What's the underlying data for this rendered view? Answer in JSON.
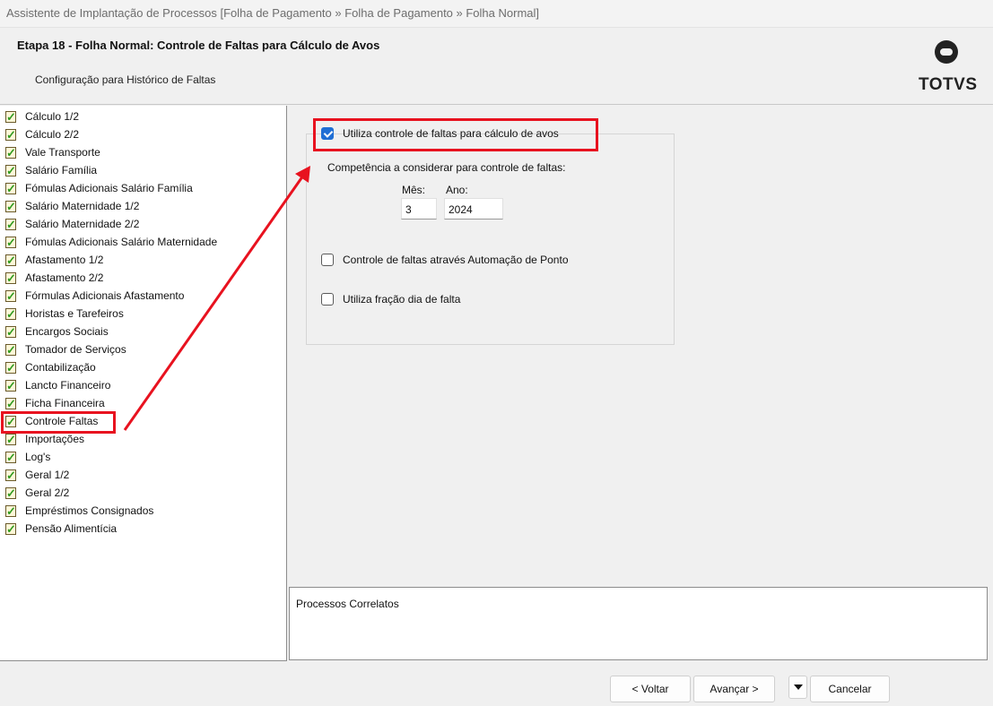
{
  "window": {
    "title": "Assistente de Implantação de Processos [Folha de Pagamento » Folha de Pagamento » Folha Normal]"
  },
  "header": {
    "step_title": "Etapa 18 - Folha Normal: Controle de Faltas para Cálculo de Avos",
    "subtitle": "Configuração para Histórico de Faltas",
    "logo_text": "TOTVS"
  },
  "tree": {
    "items": [
      {
        "label": "Cálculo 1/2"
      },
      {
        "label": "Cálculo 2/2"
      },
      {
        "label": "Vale Transporte"
      },
      {
        "label": "Salário Família"
      },
      {
        "label": "Fómulas Adicionais Salário Família"
      },
      {
        "label": "Salário Maternidade 1/2"
      },
      {
        "label": "Salário Maternidade 2/2"
      },
      {
        "label": "Fómulas Adicionais Salário Maternidade"
      },
      {
        "label": "Afastamento 1/2"
      },
      {
        "label": "Afastamento 2/2"
      },
      {
        "label": "Fórmulas Adicionais Afastamento"
      },
      {
        "label": "Horistas e Tarefeiros"
      },
      {
        "label": "Encargos Sociais"
      },
      {
        "label": "Tomador de Serviços"
      },
      {
        "label": "Contabilização"
      },
      {
        "label": "Lancto Financeiro"
      },
      {
        "label": "Ficha Financeira"
      },
      {
        "label": "Controle Faltas"
      },
      {
        "label": "Importações"
      },
      {
        "label": "Log's"
      },
      {
        "label": "Geral 1/2"
      },
      {
        "label": "Geral 2/2"
      },
      {
        "label": "Empréstimos Consignados"
      },
      {
        "label": "Pensão Alimentícia"
      }
    ],
    "selected_label": "Controle Faltas"
  },
  "form": {
    "use_control": {
      "label": "Utiliza controle de faltas para cálculo de avos",
      "checked": true
    },
    "competencia_label": "Competência a considerar para controle de faltas:",
    "mes_label": "Mês:",
    "ano_label": "Ano:",
    "mes_value": "3",
    "ano_value": "2024",
    "ponto": {
      "label": "Controle de faltas através Automação de Ponto",
      "checked": false
    },
    "fracao": {
      "label": "Utiliza fração dia de falta",
      "checked": false
    }
  },
  "correlatos": {
    "label": "Processos Correlatos"
  },
  "footer": {
    "back_label": "< Voltar",
    "next_label": "Avançar >",
    "cancel_label": "Cancelar"
  },
  "colors": {
    "highlight": "#e8121f",
    "checkbox_accent": "#1f6ed4",
    "check_icon": "#2f9a1f"
  },
  "icons": [
    "checked-document-icon",
    "chevron-down-icon",
    "totvs-logo-icon"
  ]
}
